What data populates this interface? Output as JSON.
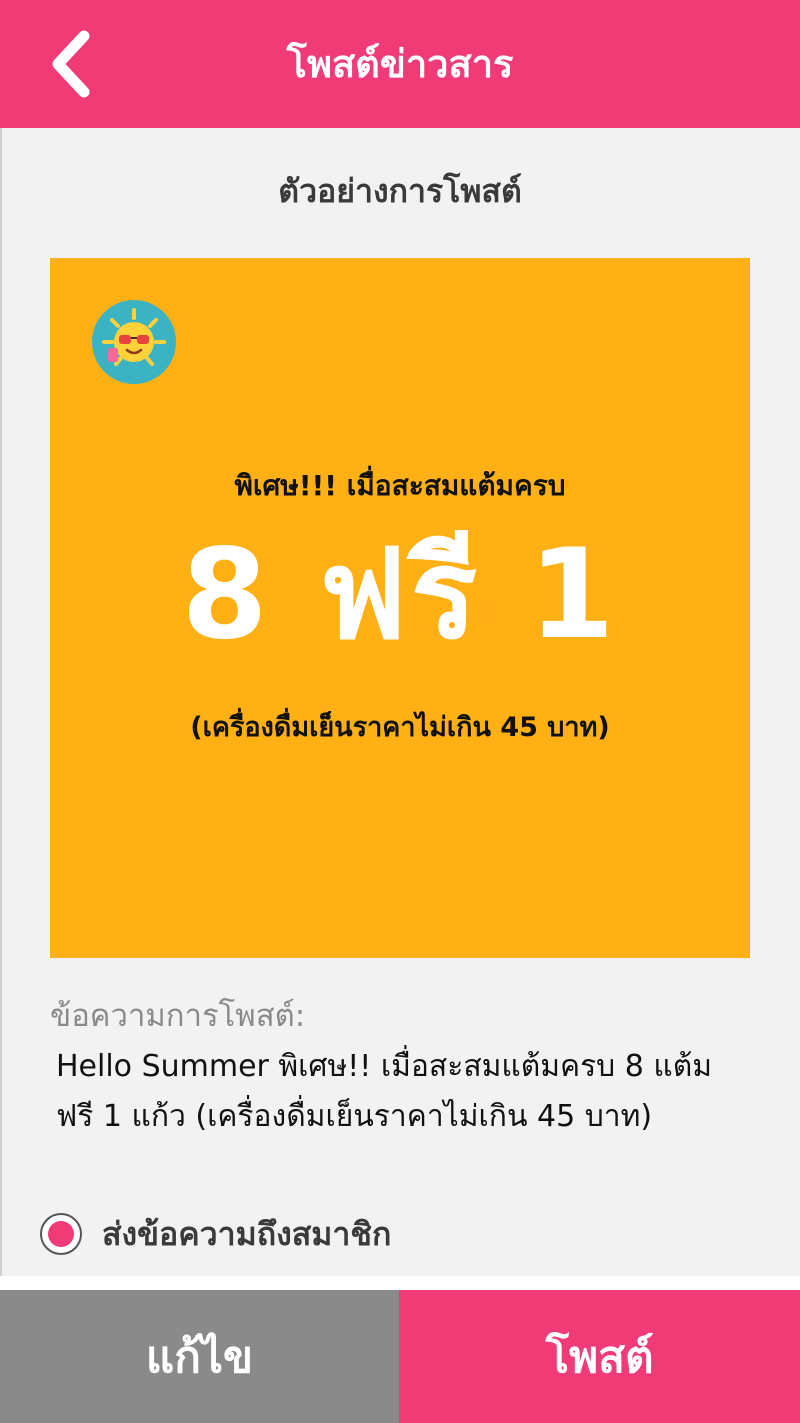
{
  "header": {
    "title": "โพสต์ข่าวสาร",
    "back_icon": "chevron-left-icon",
    "bg_color": "#f03b76"
  },
  "preview": {
    "heading": "ตัวอย่างการโพสต์",
    "card_color": "#ffb015",
    "badge_icon": "sun-sunglasses-icon",
    "line1": "พิเศษ!!! เมื่อสะสมแต้มครบ",
    "big_text": "8 ฟรี 1",
    "line3": "(เครื่องดื่มเย็นราคาไม่เกิน 45 บาท)"
  },
  "message": {
    "label": "ข้อความการโพสต์:",
    "body": "Hello Summer พิเศษ!! เมื่อสะสมแต้มครบ 8 แต้ม ฟรี 1 แก้ว (เครื่องดื่มเย็นราคาไม่เกิน 45 บาท)"
  },
  "option": {
    "label": "ส่งข้อความถึงสมาชิก",
    "selected": true
  },
  "actions": {
    "edit_label": "แก้ไข",
    "post_label": "โพสต์",
    "edit_color": "#8a8a8a",
    "post_color": "#f03b76"
  }
}
